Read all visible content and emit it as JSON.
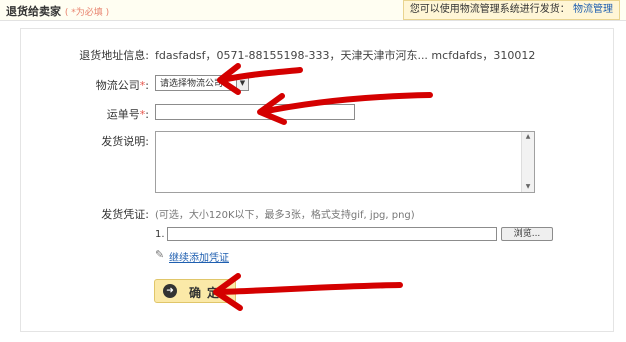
{
  "header": {
    "title": "退货给卖家",
    "required_note": "( *为必填 )",
    "tip_text": "您可以使用物流管理系统进行发货：",
    "tip_link": "物流管理"
  },
  "form": {
    "address_label": "退货地址信息:",
    "address_value": "fdasfadsf，0571-88155198-333，天津天津市河东... mcfdafds，310012",
    "logistics_label": "物流公司",
    "logistics_select": "请选择物流公司",
    "tracking_label": "运单号",
    "shipping_note_label": "发货说明:",
    "voucher_label": "发货凭证:",
    "voucher_hint": "(可选，大小120K以下，最多3张，格式支持gif, jpg, png)",
    "file_row_number": "1.",
    "browse_label": "浏览...",
    "add_voucher_link": "继续添加凭证",
    "confirm_label": "确定",
    "required_mark": "*",
    "colon": ":"
  }
}
